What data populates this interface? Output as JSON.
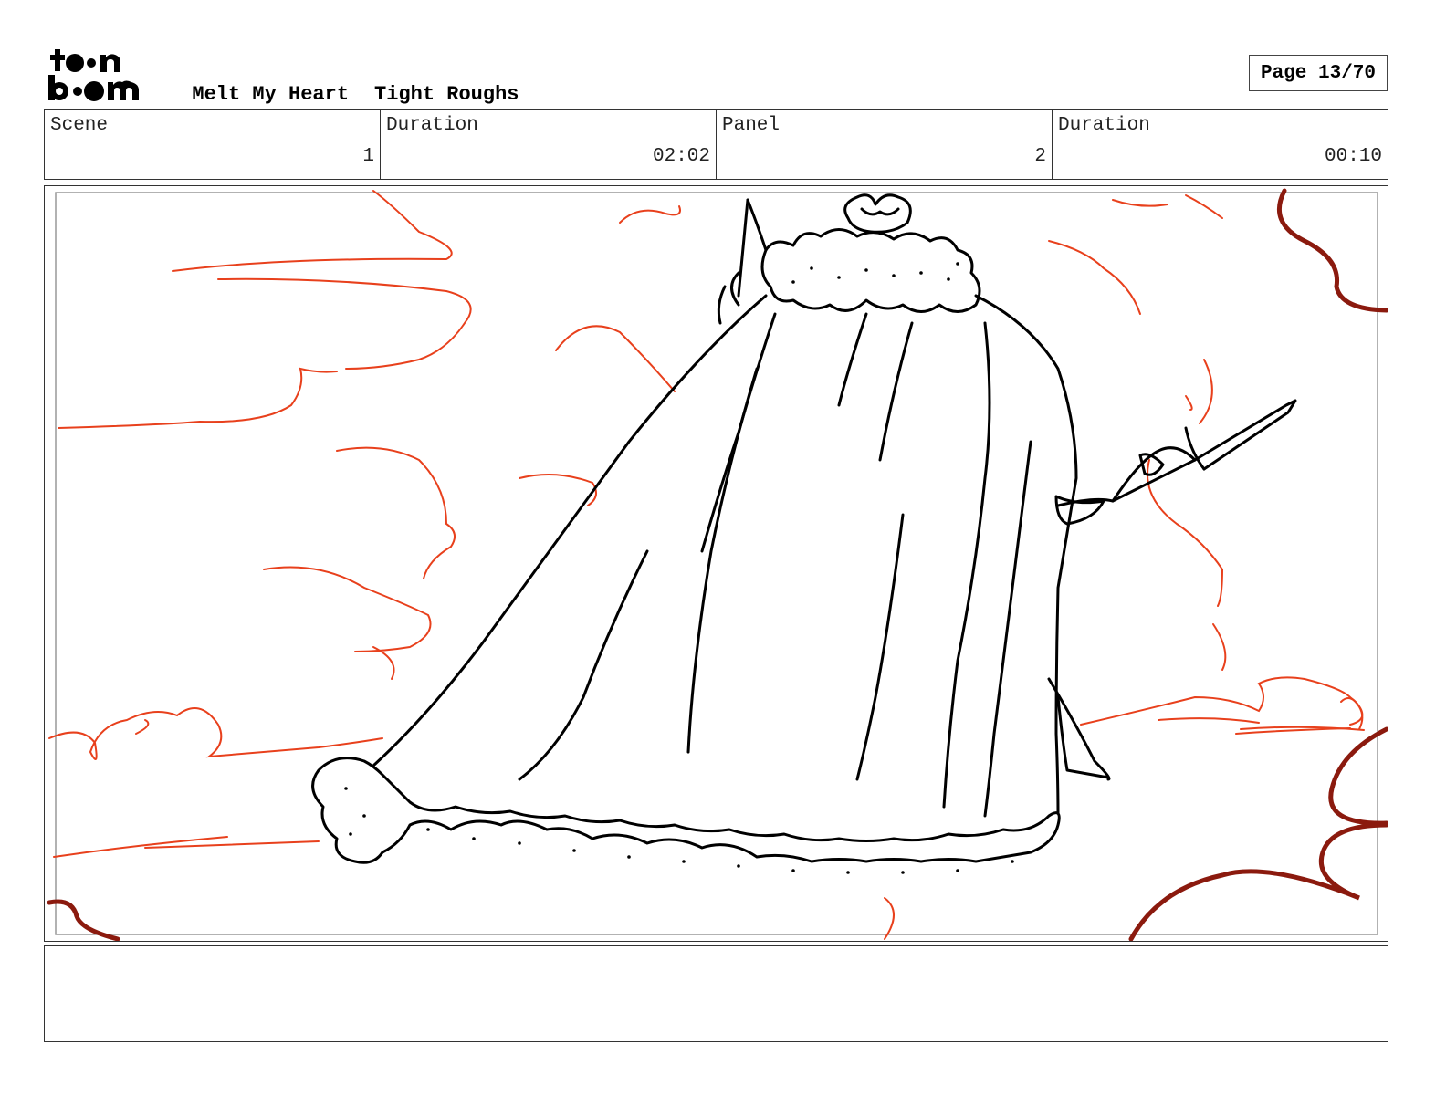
{
  "header": {
    "logo_text_top": "toon",
    "logo_text_bottom": "boom",
    "project_title": "Melt My Heart",
    "subtitle": "Tight Roughs",
    "page_label": "Page 13/70"
  },
  "info_row": [
    {
      "label": "Scene",
      "value": "1"
    },
    {
      "label": "Duration",
      "value": "02:02"
    },
    {
      "label": "Panel",
      "value": "2"
    },
    {
      "label": "Duration",
      "value": "00:10"
    }
  ],
  "colors": {
    "cloud_red": "#e8401c",
    "cloud_dark": "#8b1a0e",
    "ink": "#000000"
  },
  "notes": {
    "text": ""
  }
}
